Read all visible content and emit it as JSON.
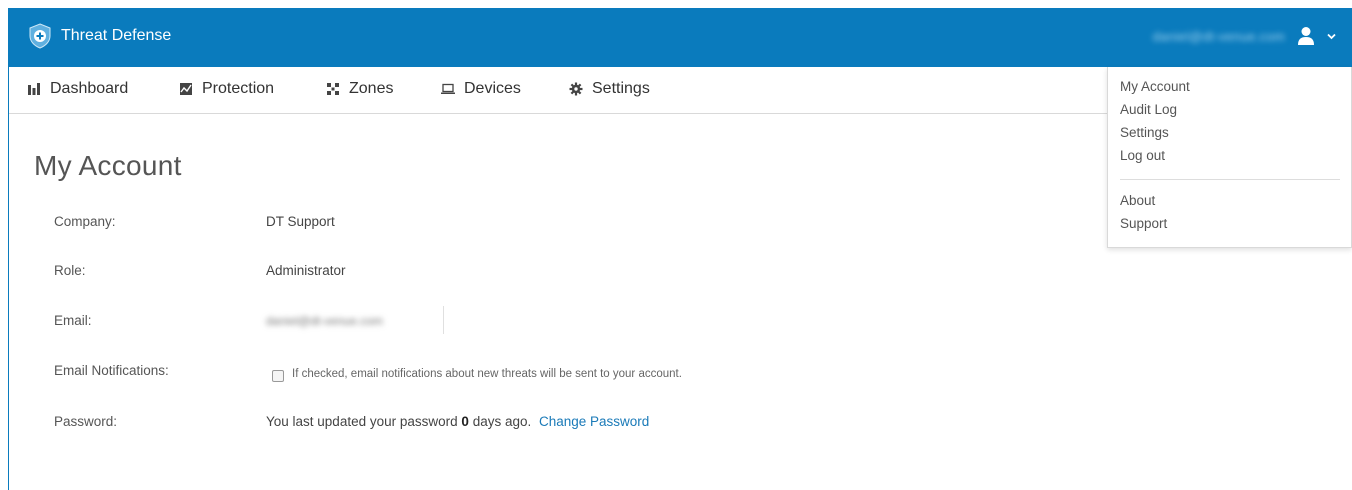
{
  "app": {
    "title": "Threat Defense",
    "user_email": "daniel@dt-venue.com",
    "accent_color": "#0a7bbd"
  },
  "nav": {
    "items": [
      {
        "label": "Dashboard",
        "icon": "bar-chart-icon"
      },
      {
        "label": "Protection",
        "icon": "protection-icon"
      },
      {
        "label": "Zones",
        "icon": "zones-icon"
      },
      {
        "label": "Devices",
        "icon": "laptop-icon"
      },
      {
        "label": "Settings",
        "icon": "gear-icon"
      }
    ]
  },
  "user_menu": {
    "items": [
      "My Account",
      "Audit Log",
      "Settings",
      "Log out"
    ],
    "secondary_items": [
      "About",
      "Support"
    ]
  },
  "page": {
    "title": "My Account",
    "fields": {
      "company_label": "Company:",
      "company_value": "DT Support",
      "role_label": "Role:",
      "role_value": "Administrator",
      "email_label": "Email:",
      "email_value": "daniel@dt-venue.com",
      "notifications_label": "Email Notifications:",
      "notifications_text": "If checked, email notifications about new threats will be sent to your account.",
      "notifications_checked": false,
      "password_label": "Password:",
      "password_text_prefix": "You last updated your password",
      "password_days": "0",
      "password_text_suffix": "days ago.",
      "change_password_link": "Change Password"
    }
  }
}
